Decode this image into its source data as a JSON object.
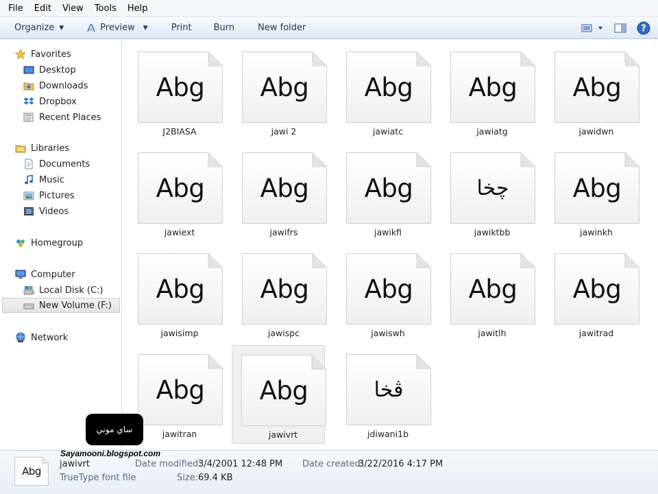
{
  "menu": [
    "File",
    "Edit",
    "View",
    "Tools",
    "Help"
  ],
  "toolbar": {
    "organize": "Organize",
    "preview": "Preview",
    "print": "Print",
    "burn": "Burn",
    "new_folder": "New folder"
  },
  "nav": {
    "favorites": "Favorites",
    "desktop": "Desktop",
    "downloads": "Downloads",
    "dropbox": "Dropbox",
    "recent_places": "Recent Places",
    "libraries": "Libraries",
    "documents": "Documents",
    "music": "Music",
    "pictures": "Pictures",
    "videos": "Videos",
    "homegroup": "Homegroup",
    "computer": "Computer",
    "local_disk": "Local Disk (C:)",
    "new_volume": "New Volume (F:)",
    "network": "Network"
  },
  "files": [
    {
      "name": "J2BIASA",
      "preview": "Abg"
    },
    {
      "name": "jawi 2",
      "preview": "Abg"
    },
    {
      "name": "jawiatc",
      "preview": "Abg"
    },
    {
      "name": "jawiatg",
      "preview": "Abg"
    },
    {
      "name": "jawidwn",
      "preview": "Abg"
    },
    {
      "name": "jawiext",
      "preview": "Abg"
    },
    {
      "name": "jawifrs",
      "preview": "Abg"
    },
    {
      "name": "jawikfi",
      "preview": "Abg"
    },
    {
      "name": "jawiktbb",
      "preview": "چخا"
    },
    {
      "name": "jawinkh",
      "preview": "Abg"
    },
    {
      "name": "jawisimp",
      "preview": "Abg"
    },
    {
      "name": "jawispc",
      "preview": "Abg"
    },
    {
      "name": "jawiswh",
      "preview": "Abg"
    },
    {
      "name": "jawitlh",
      "preview": "Abg"
    },
    {
      "name": "jawitrad",
      "preview": "Abg"
    },
    {
      "name": "jawitran",
      "preview": "Abg"
    },
    {
      "name": "jawivrt",
      "preview": "Abg"
    },
    {
      "name": "jdiwani1b",
      "preview": "ڤخا"
    }
  ],
  "details": {
    "preview": "Abg",
    "name": "jawivrt",
    "type": "TrueType font file",
    "date_modified_label": "Date modified:",
    "date_modified": "3/4/2001 12:48 PM",
    "date_created_label": "Date created:",
    "date_created": "3/22/2016 4:17 PM",
    "size_label": "Size:",
    "size": "69.4 KB"
  },
  "watermark": {
    "badge": "ساي موني",
    "site": "Sayamooni.blogspot.com"
  }
}
